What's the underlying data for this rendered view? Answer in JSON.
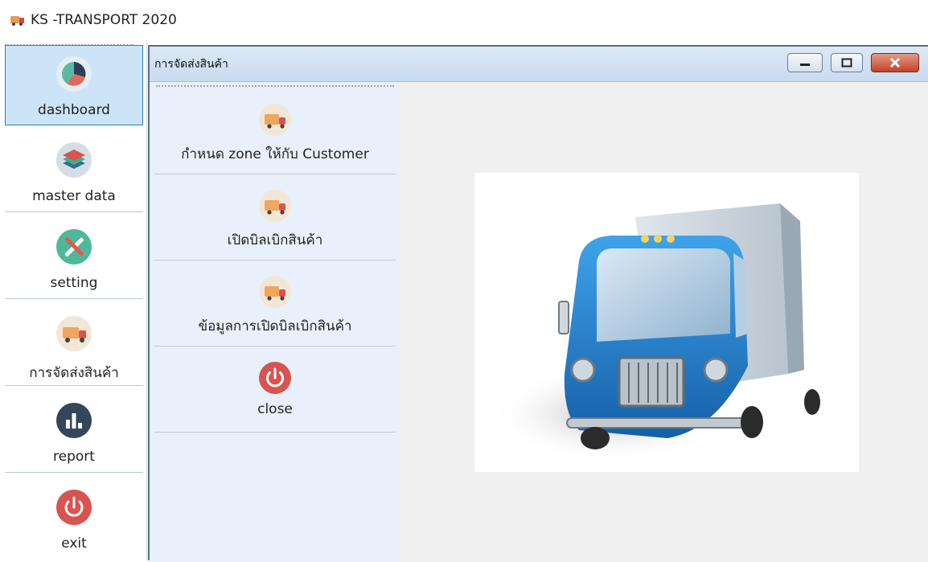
{
  "app": {
    "title": "KS -TRANSPORT 2020"
  },
  "sidebar": {
    "items": [
      {
        "label": "dashboard",
        "icon": "pie-chart-icon",
        "active": true
      },
      {
        "label": "master data",
        "icon": "layers-icon"
      },
      {
        "label": "setting",
        "icon": "tools-icon"
      },
      {
        "label": "การจัดส่งสินค้า",
        "icon": "truck-icon"
      },
      {
        "label": "report",
        "icon": "bar-chart-icon"
      },
      {
        "label": "exit",
        "icon": "power-icon"
      }
    ]
  },
  "window": {
    "title": "การจัดส่งสินค้า",
    "controls": [
      "minimize",
      "maximize",
      "close"
    ]
  },
  "menu": {
    "items": [
      {
        "label": "กำหนด zone ให้กับ Customer",
        "icon": "truck-icon"
      },
      {
        "label": "เปิดบิลเบิกสินค้า",
        "icon": "truck-icon"
      },
      {
        "label": "ข้อมูลการเปิดบิลเบิกสินค้า",
        "icon": "truck-icon"
      },
      {
        "label": "close",
        "icon": "power-icon"
      }
    ]
  },
  "content": {
    "image": "delivery-truck-illustration"
  },
  "colors": {
    "active_bg": "#cce4f7",
    "active_border": "#2e7bc7",
    "menu_bg": "#e8f1fb",
    "power_red": "#d9534f",
    "truck_orange": "#f0a65c",
    "truck_blue": "#1f7fd0"
  }
}
